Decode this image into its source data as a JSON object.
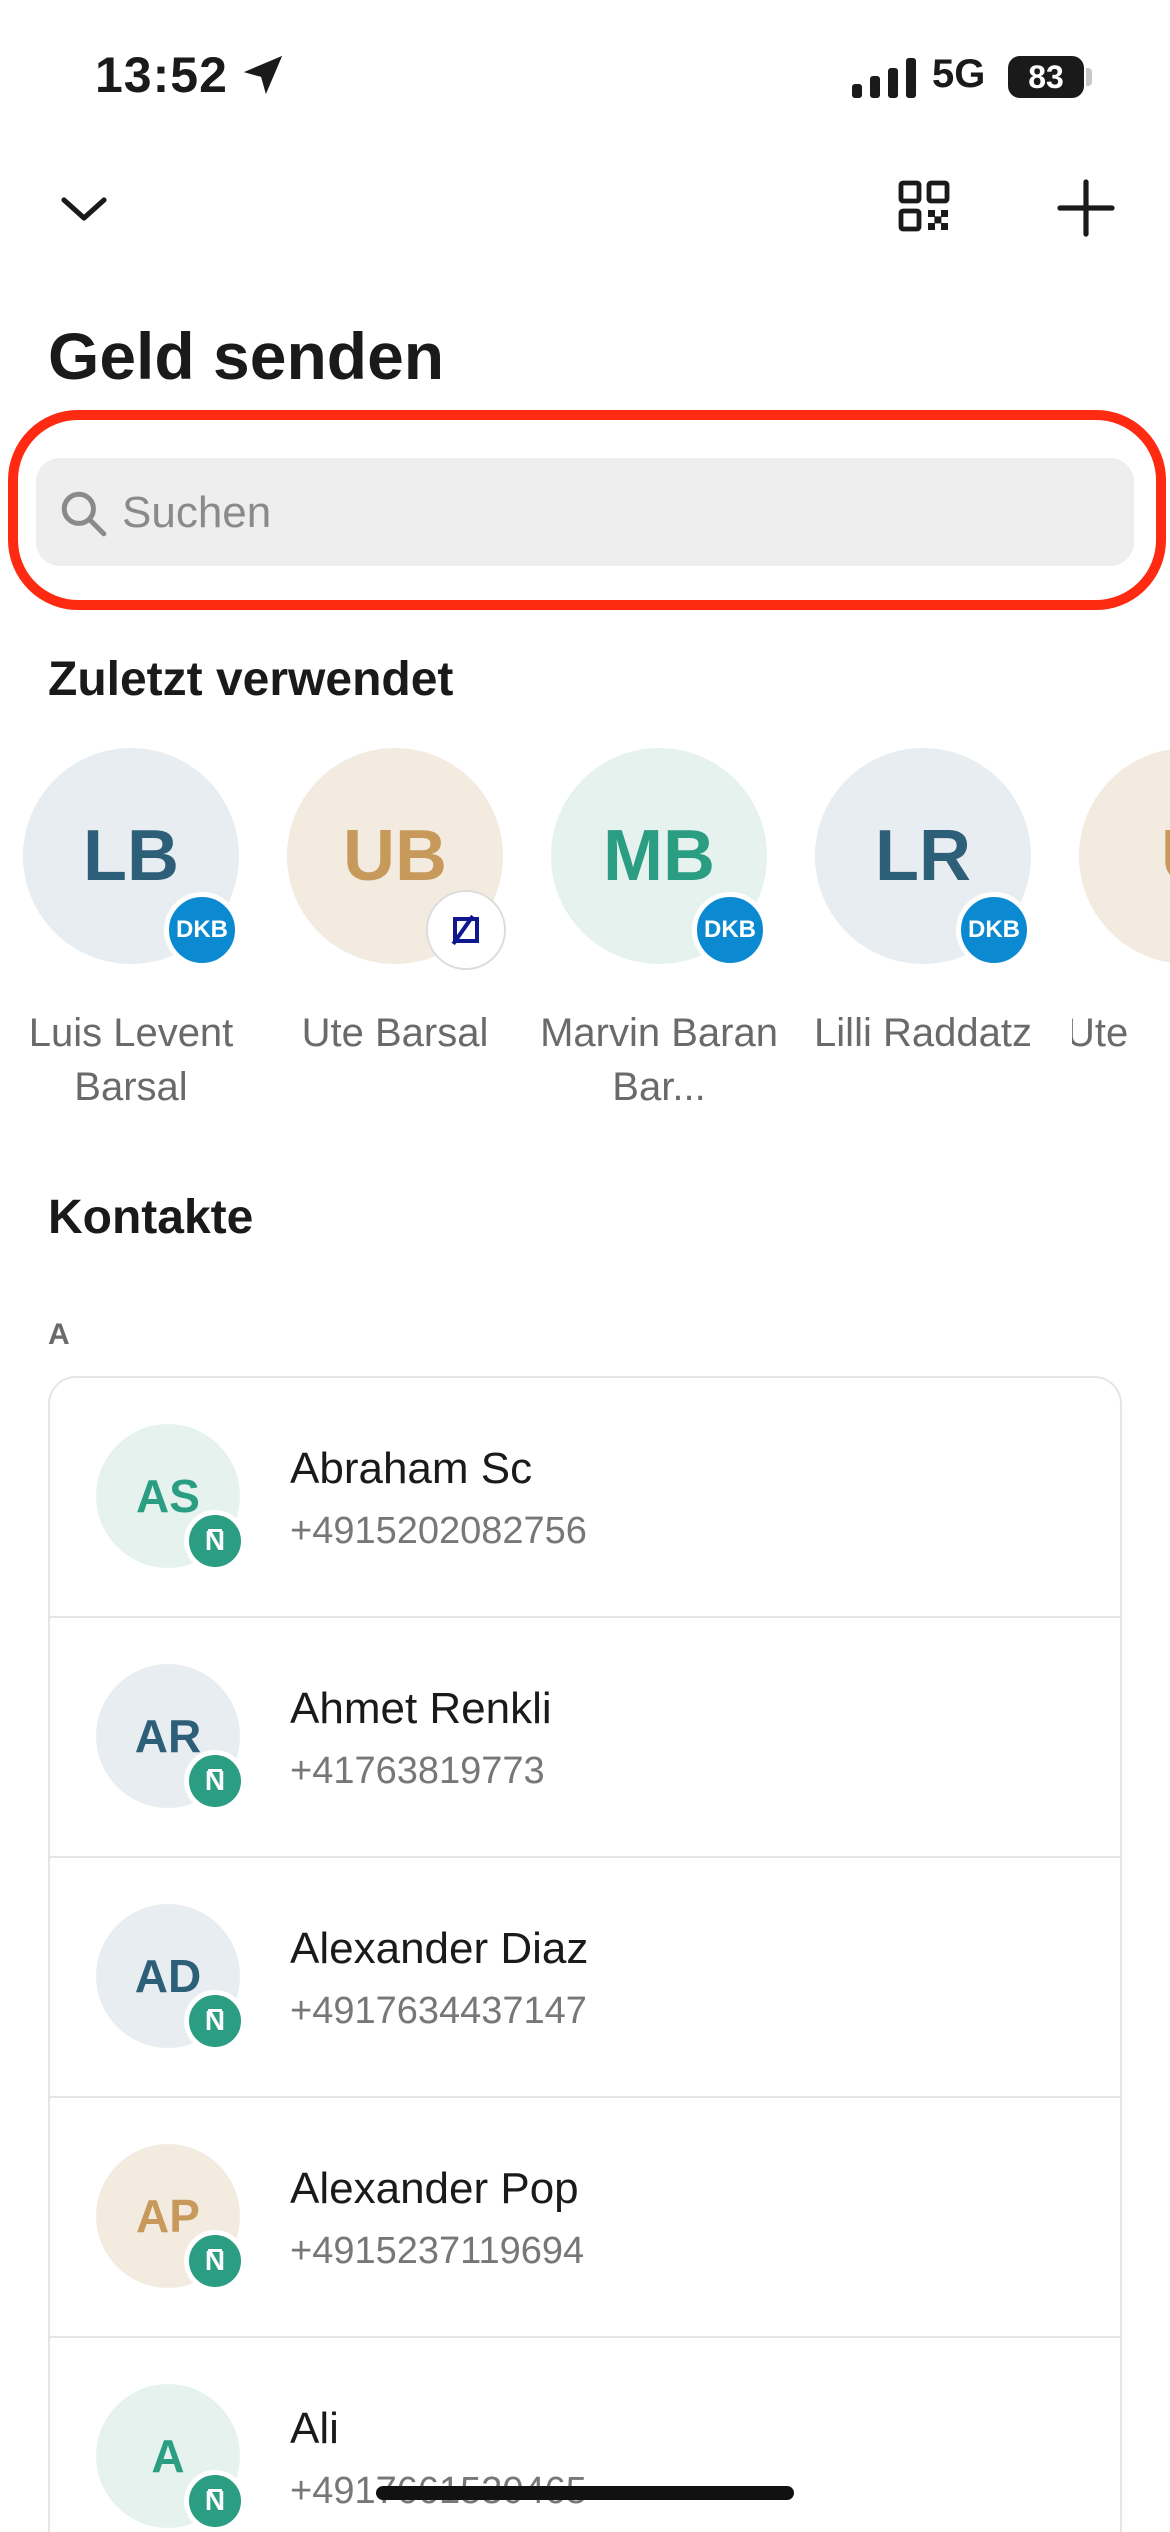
{
  "status_bar": {
    "time": "13:52",
    "network": "5G",
    "battery": "83"
  },
  "header": {
    "title": "Geld senden"
  },
  "search": {
    "placeholder": "Suchen",
    "highlight_color": "#ff2a12"
  },
  "recent": {
    "heading": "Zuletzt verwendet",
    "items": [
      {
        "initials": "LB",
        "name": "Luis Levent Barsal",
        "bank": "DKB",
        "color": "blue"
      },
      {
        "initials": "UB",
        "name": "Ute Barsal",
        "bank": "Deutsche Bank",
        "color": "tan"
      },
      {
        "initials": "MB",
        "name": "Marvin Baran Bar...",
        "bank": "DKB",
        "color": "green"
      },
      {
        "initials": "LR",
        "name": "Lilli Raddatz",
        "bank": "DKB",
        "color": "blue"
      },
      {
        "initials": "U",
        "name": "Ute",
        "bank": "",
        "color": "tan"
      }
    ]
  },
  "contacts": {
    "heading": "Kontakte",
    "section_letter": "A",
    "items": [
      {
        "initials": "AS",
        "name": "Abraham Sc",
        "phone": "+4915202082756",
        "color": "green",
        "badge": "N"
      },
      {
        "initials": "AR",
        "name": "Ahmet Renkli",
        "phone": "+41763819773",
        "color": "blue",
        "badge": "N"
      },
      {
        "initials": "AD",
        "name": "Alexander Diaz",
        "phone": "+4917634437147",
        "color": "blue",
        "badge": "N"
      },
      {
        "initials": "AP",
        "name": "Alexander Pop",
        "phone": "+4915237119694",
        "color": "tan",
        "badge": "N"
      },
      {
        "initials": "A",
        "name": "Ali",
        "phone": "+4917661530465",
        "color": "green",
        "badge": "N"
      }
    ]
  },
  "colors": {
    "green": "#2a9d83",
    "blue": "#2e5f78",
    "tan": "#c79a5b",
    "dkb": "#0b8ad1"
  }
}
